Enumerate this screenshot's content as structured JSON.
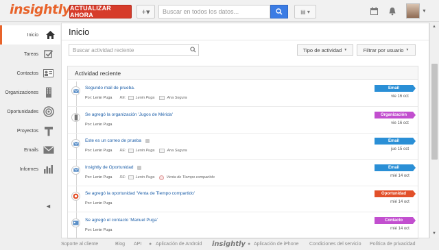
{
  "header": {
    "logo": "insightly",
    "upgrade_label": "ACTUALIZAR AHORA",
    "add_label": "+▾",
    "search_placeholder": "Buscar en todos los datos...",
    "views_label": "▤ ▾"
  },
  "sidebar": {
    "items": [
      {
        "label": "Inicio",
        "icon": "home-icon"
      },
      {
        "label": "Tareas",
        "icon": "checkbox-icon"
      },
      {
        "label": "Contactos",
        "icon": "contact-card-icon"
      },
      {
        "label": "Organizaciones",
        "icon": "building-icon"
      },
      {
        "label": "Oportunidades",
        "icon": "target-icon"
      },
      {
        "label": "Proyectos",
        "icon": "hammer-icon"
      },
      {
        "label": "Emails",
        "icon": "envelope-icon"
      },
      {
        "label": "Informes",
        "icon": "bar-chart-icon"
      }
    ]
  },
  "main": {
    "title": "Inicio",
    "activity_search_placeholder": "Buscar actividad reciente",
    "filter_type_label": "Tipo de actividad",
    "filter_user_label": "Filtrar por usuario",
    "feed_title": "Actividad reciente"
  },
  "feed": [
    {
      "title": "Segundo mail de prueba.",
      "author": "Por: Lenin Puga",
      "re": "RE:",
      "link1": "Lenin Puga",
      "link2": "Ana Segura",
      "badge": "Email",
      "badge_color": "#2a8fd6",
      "date": "vie 16 oct",
      "icon": "envelope-icon",
      "lock": false
    },
    {
      "title": "Se agregó la organización 'Jugos de Mérida'",
      "author": "Por: Lenin Puga",
      "re": "",
      "link1": "",
      "link2": "",
      "badge": "Organización",
      "badge_color": "#c24fcf",
      "date": "vie 16 oct",
      "icon": "building-icon",
      "lock": false
    },
    {
      "title": "Este es un correo de prueba",
      "author": "Por: Lenin Puga",
      "re": "RE:",
      "link1": "Lenin Puga",
      "link2": "Ana Segura",
      "badge": "Email",
      "badge_color": "#2a8fd6",
      "date": "jue 15 oct",
      "icon": "envelope-icon",
      "lock": true
    },
    {
      "title": "Insightly de Oportunidad",
      "author": "Por: Lenin Puga",
      "re": "RE:",
      "link1": "Lenin Puga",
      "link2": "Venta de Tiempo compartido",
      "badge": "Email",
      "badge_color": "#2a8fd6",
      "date": "mié 14 oct",
      "icon": "envelope-icon",
      "lock": true
    },
    {
      "title": "Se agregó la oportunidad 'Venta de Tiempo compartido'",
      "author": "Por: Lenin Puga",
      "re": "",
      "link1": "",
      "link2": "",
      "badge": "Oportunidad",
      "badge_color": "#e2502a",
      "date": "mié 14 oct",
      "icon": "target-icon",
      "lock": false
    },
    {
      "title": "Se agregó el contacto 'Manuel Puga'",
      "author": "Por: Lenin Puga",
      "re": "",
      "link1": "",
      "link2": "",
      "badge": "Contacto",
      "badge_color": "#c24fcf",
      "date": "mié 14 oct",
      "icon": "contact-card-icon",
      "lock": false
    }
  ],
  "footer": {
    "support": "Soporte al cliente",
    "blog": "Blog",
    "api": "API",
    "android": "Aplicación de Android",
    "logo": "insightly",
    "iphone": "Aplicación de iPhone",
    "terms": "Condiciones del servicio",
    "privacy": "Política de privacidad"
  }
}
